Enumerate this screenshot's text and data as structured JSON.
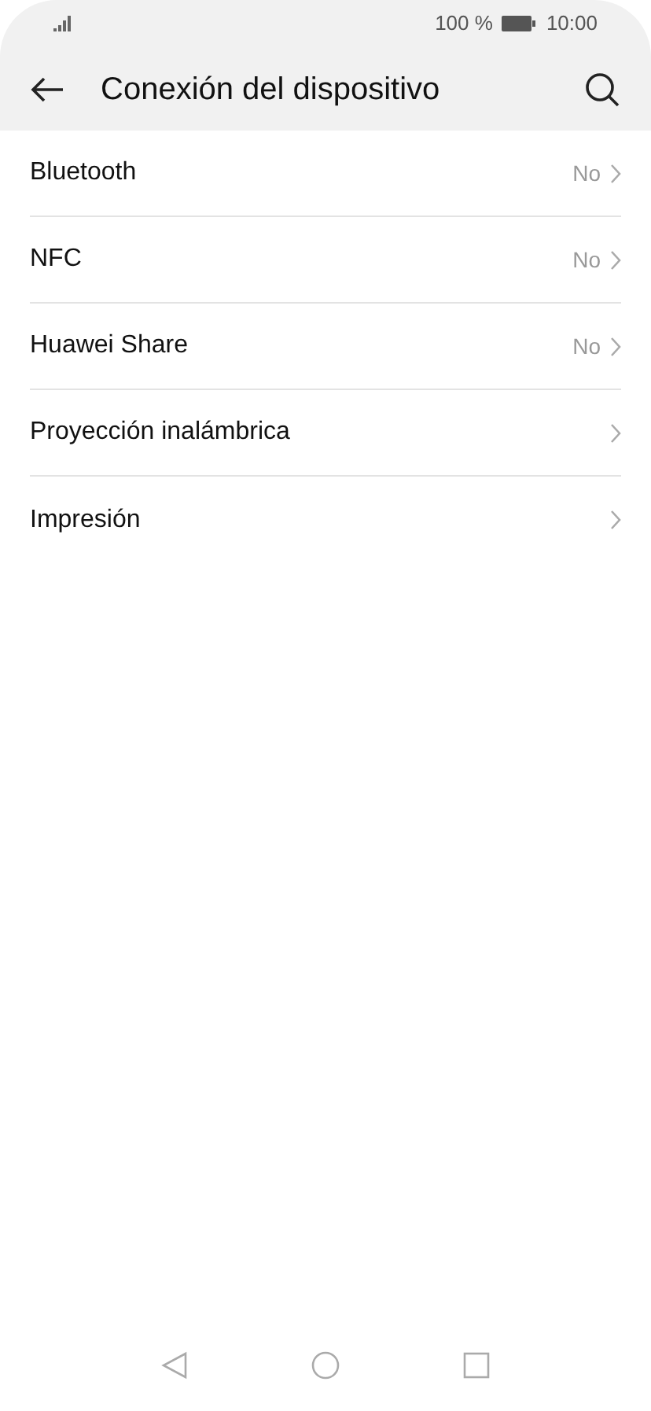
{
  "status_bar": {
    "battery_percent": "100 %",
    "time": "10:00"
  },
  "title": "Conexión del dispositivo",
  "items": [
    {
      "label": "Bluetooth",
      "value": "No"
    },
    {
      "label": "NFC",
      "value": "No"
    },
    {
      "label": "Huawei Share",
      "value": "No"
    },
    {
      "label": "Proyección inalámbrica"
    },
    {
      "label": "Impresión"
    }
  ]
}
